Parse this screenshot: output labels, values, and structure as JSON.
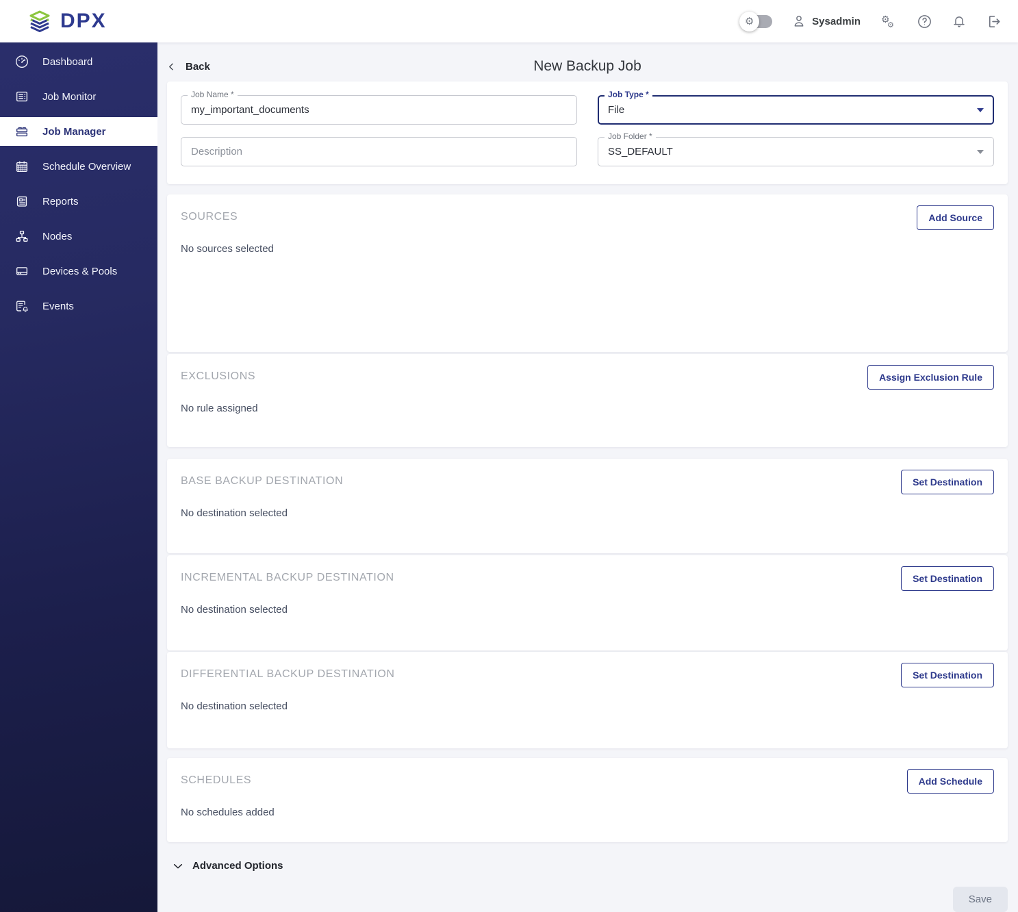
{
  "app": {
    "logo_text": "DPX",
    "colors": {
      "accent": "#2e3a8c",
      "logo_green": "#8cc63f",
      "sidebar_top": "#2a2e6b",
      "sidebar_bottom": "#151839",
      "page_bg": "#f4f5f9",
      "focused_field_border": "#202d72",
      "save_disabled_bg": "#e4e7ee"
    }
  },
  "header": {
    "user_name": "Sysadmin"
  },
  "sidebar": {
    "items": [
      {
        "label": "Dashboard",
        "selected": false
      },
      {
        "label": "Job Monitor",
        "selected": false
      },
      {
        "label": "Job Manager",
        "selected": true
      },
      {
        "label": "Schedule Overview",
        "selected": false
      },
      {
        "label": "Reports",
        "selected": false
      },
      {
        "label": "Nodes",
        "selected": false
      },
      {
        "label": "Devices & Pools",
        "selected": false
      },
      {
        "label": "Events",
        "selected": false
      }
    ]
  },
  "page": {
    "back_label": "Back",
    "title": "New Backup Job"
  },
  "form": {
    "job_name": {
      "label": "Job Name *",
      "value": "my_important_documents"
    },
    "description": {
      "placeholder": "Description"
    },
    "job_type": {
      "label": "Job Type *",
      "value": "File"
    },
    "job_folder": {
      "label": "Job Folder *",
      "value": "SS_DEFAULT"
    }
  },
  "sections": [
    {
      "title": "SOURCES",
      "empty_text": "No sources selected",
      "action_label": "Add Source"
    },
    {
      "title": "EXCLUSIONS",
      "empty_text": "No rule assigned",
      "action_label": "Assign Exclusion Rule"
    },
    {
      "title": "BASE BACKUP DESTINATION",
      "empty_text": "No destination selected",
      "action_label": "Set Destination"
    },
    {
      "title": "INCREMENTAL BACKUP DESTINATION",
      "empty_text": "No destination selected",
      "action_label": "Set Destination"
    },
    {
      "title": "DIFFERENTIAL BACKUP DESTINATION",
      "empty_text": "No destination selected",
      "action_label": "Set Destination"
    },
    {
      "title": "SCHEDULES",
      "empty_text": "No schedules added",
      "action_label": "Add Schedule"
    }
  ],
  "footer": {
    "advanced_options_label": "Advanced Options",
    "save_label": "Save"
  }
}
